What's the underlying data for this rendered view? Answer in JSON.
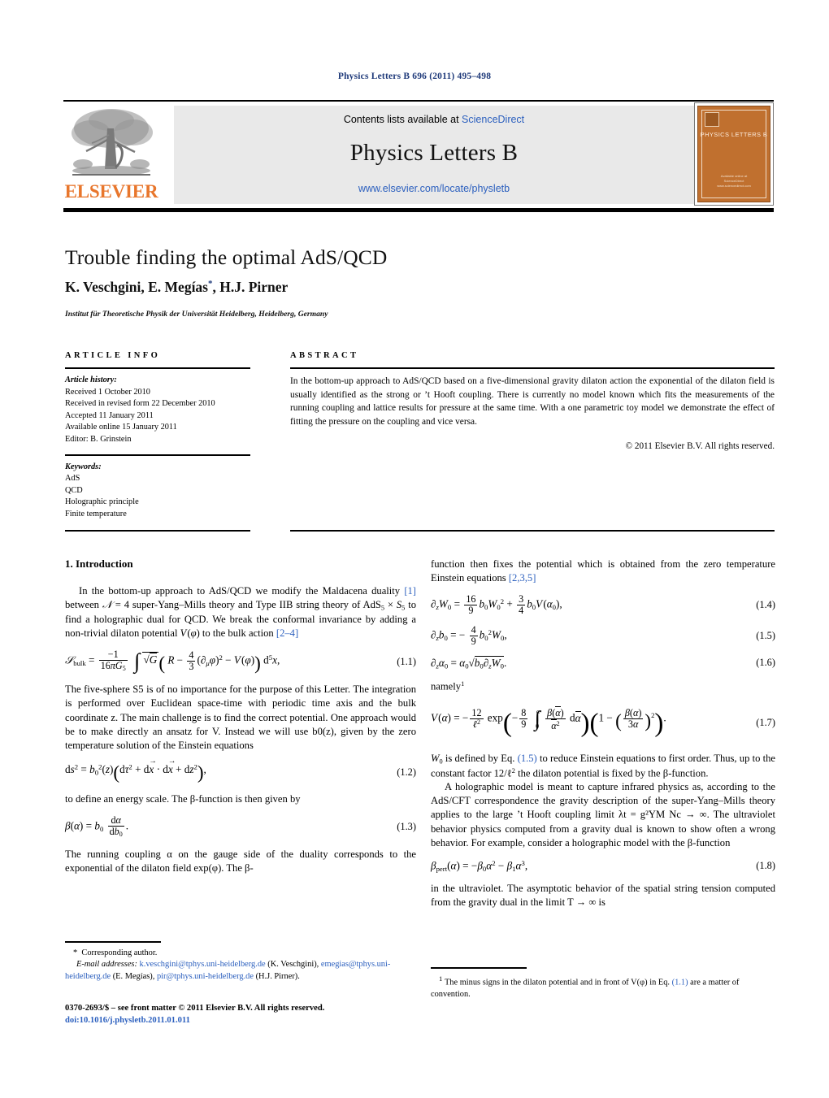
{
  "running_head": "Physics Letters B 696 (2011) 495–498",
  "masthead": {
    "contents_prefix": "Contents lists available at ",
    "sciencedirect": "ScienceDirect",
    "journal_title": "Physics Letters B",
    "journal_url": "www.elsevier.com/locate/physletb",
    "publisher_word": "ELSEVIER",
    "publisher_logo_icon": "elsevier-tree-icon",
    "cover": {
      "title": "PHYSICS LETTERS B",
      "foot_line1": "Available online at",
      "foot_line2": "ScienceDirect",
      "foot_line3": "www.sciencedirect.com",
      "bottom_note": "www.elsevier.com/locate/physletb"
    }
  },
  "title": "Trouble finding the optimal AdS/QCD",
  "authors_plain": "K. Veschgini, E. Megías",
  "authors_tail": ", H.J. Pirner",
  "corresponding_marker": "*",
  "affiliation": "Institut für Theoretische Physik der Universität Heidelberg, Heidelberg, Germany",
  "article_info": {
    "heading": "ARTICLE INFO",
    "history_label": "Article history:",
    "history": [
      "Received 1 October 2010",
      "Received in revised form 22 December 2010",
      "Accepted 11 January 2011",
      "Available online 15 January 2011",
      "Editor: B. Grinstein"
    ],
    "keywords_label": "Keywords:",
    "keywords": [
      "AdS",
      "QCD",
      "Holographic principle",
      "Finite temperature"
    ]
  },
  "abstract": {
    "heading": "ABSTRACT",
    "text": "In the bottom-up approach to AdS/QCD based on a five-dimensional gravity dilaton action the exponential of the dilaton field is usually identified as the strong or ’t Hooft coupling. There is currently no model known which fits the measurements of the running coupling and lattice results for pressure at the same time. With a one parametric toy model we demonstrate the effect of fitting the pressure on the coupling and vice versa.",
    "copyright": "© 2011 Elsevier B.V. All rights reserved."
  },
  "body": {
    "section1_heading": "1. Introduction",
    "p1_a": "In the bottom-up approach to AdS/QCD we modify the Maldacena duality ",
    "p1_ref1": "[1]",
    "p1_b": " between ",
    "p1_c": " super-Yang–Mills theory and Type IIB string theory of ",
    "p1_d": " to find a holographic dual for QCD. We break the conformal invariance by adding a non-trivial dilaton potential ",
    "p1_e": " to the bulk action ",
    "p1_ref2": "[2–4]",
    "eq11_num": "(1.1)",
    "p2": "The five-sphere S5 is of no importance for the purpose of this Letter. The integration is performed over Euclidean space-time with periodic time axis and the bulk coordinate z. The main challenge is to find the correct potential. One approach would be to make directly an ansatz for V. Instead we will use b0(z), given by the zero temperature solution of the Einstein equations",
    "eq12_num": "(1.2)",
    "p3": "to define an energy scale. The β-function is then given by",
    "eq13_num": "(1.3)",
    "p4": "The running coupling α on the gauge side of the duality corresponds to the exponential of the dilaton field exp(φ). The β-",
    "r_p1_a": "function then fixes the potential which is obtained from the zero temperature Einstein equations ",
    "r_p1_ref": "[2,3,5]",
    "eq14_num": "(1.4)",
    "eq15_num": "(1.5)",
    "eq16_num": "(1.6)",
    "namely": "namely",
    "namely_sup": "1",
    "eq17_num": "(1.7)",
    "r_p2_a": "W",
    "r_p2_b": " is defined by Eq. ",
    "r_p2_ref": "(1.5)",
    "r_p2_c": " to reduce Einstein equations to first order. Thus, up to the constant factor 12/ℓ",
    "r_p2_d": " the dilaton potential is fixed by the β-function.",
    "r_p3": "A holographic model is meant to capture infrared physics as, according to the AdS/CFT correspondence the gravity description of the super-Yang–Mills theory applies to the large ’t Hooft coupling limit λt = g²YM Nc → ∞. The ultraviolet behavior physics computed from a gravity dual is known to show often a wrong behavior. For example, consider a holographic model with the β-function",
    "eq18_num": "(1.8)",
    "r_p4": "in the ultraviolet. The asymptotic behavior of the spatial string tension computed from the gravity dual in the limit T → ∞ is"
  },
  "footnotes": {
    "left_marker": "*",
    "left_corresponding": "Corresponding author.",
    "email_label": "E-mail addresses:",
    "email1": "k.veschgini@tphys.uni-heidelberg.de",
    "email1_owner": "(K. Veschgini),",
    "email2": "emegias@tphys.uni-heidelberg.de",
    "email2_owner": "(E. Megías),",
    "email3": "pir@tphys.uni-heidelberg.de",
    "email3_owner": "(H.J. Pirner).",
    "right_marker": "1",
    "right_text_a": "The minus signs in the dilaton potential and in front of V(φ) in Eq. ",
    "right_ref": "(1.1)",
    "right_text_b": " are a matter of convention."
  },
  "imprint": {
    "line1": "0370-2693/$ – see front matter © 2011 Elsevier B.V. All rights reserved.",
    "doi": "doi:10.1016/j.physletb.2011.01.011"
  },
  "colors": {
    "link": "#2b5fbe",
    "running_head": "#1f3a7a",
    "elsevier_orange": "#E8762C",
    "panel_grey": "#e9e9e9",
    "cover_orange": "#C0702F"
  }
}
